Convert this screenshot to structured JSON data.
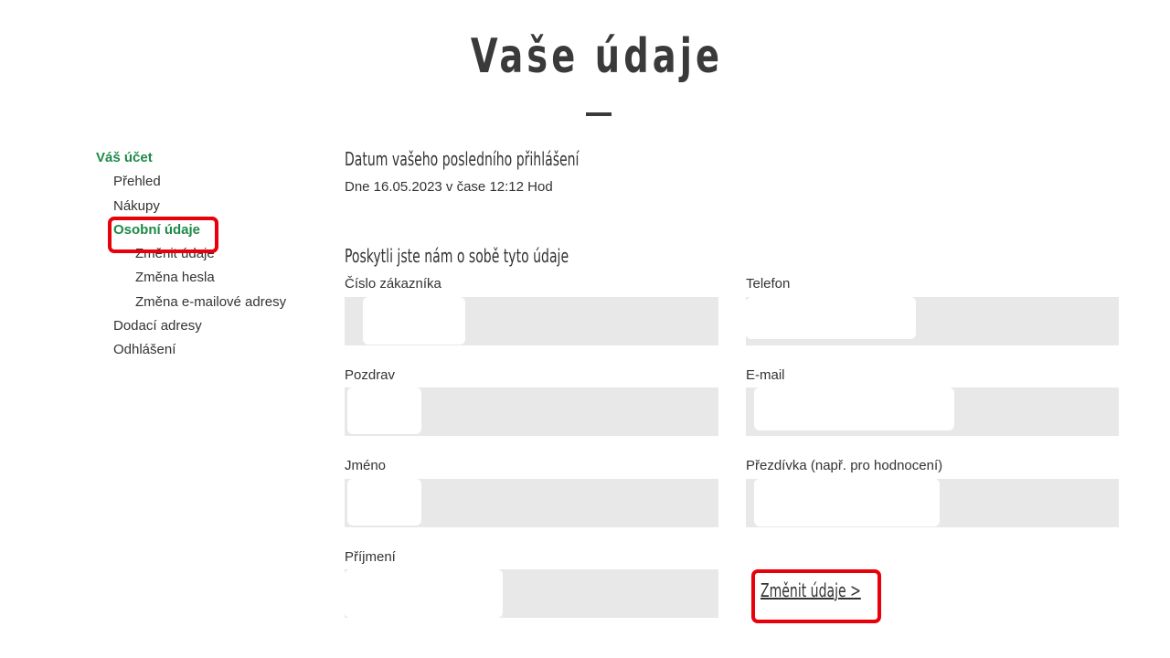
{
  "page_title": "Vaše údaje",
  "sidebar": {
    "account": "Váš účet",
    "items": [
      {
        "label": "Přehled"
      },
      {
        "label": "Nákupy"
      },
      {
        "label": "Osobní údaje"
      },
      {
        "label": "Změnit údaje"
      },
      {
        "label": "Změna hesla"
      },
      {
        "label": "Změna e-mailové adresy"
      },
      {
        "label": "Dodací adresy"
      },
      {
        "label": "Odhlášení"
      }
    ],
    "active_item": "Osobní údaje"
  },
  "last_login": {
    "heading": "Datum vašeho posledního přihlášení",
    "text": "Dne 16.05.2023 v čase 12:12 Hod"
  },
  "profile": {
    "heading": "Poskytli jste nám o sobě tyto údaje",
    "fields": {
      "customer_number": {
        "label": "Číslo zákazníka"
      },
      "phone": {
        "label": "Telefon"
      },
      "salutation": {
        "label": "Pozdrav"
      },
      "email": {
        "label": "E-mail"
      },
      "first_name": {
        "label": "Jméno"
      },
      "nickname": {
        "label": "Přezdívka (např. pro hodnocení)"
      },
      "last_name": {
        "label": "Příjmení"
      }
    },
    "edit_link": "Změnit údaje >"
  },
  "colors": {
    "accent_green": "#1e8a48",
    "highlight_red": "#e8000a",
    "field_background": "#e8e8e8",
    "text": "#333333"
  }
}
